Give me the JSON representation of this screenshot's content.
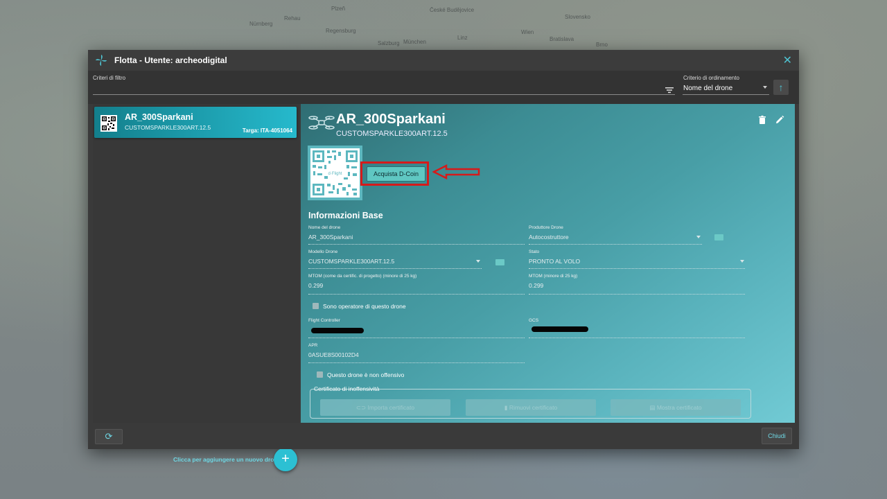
{
  "map": {
    "labels": [
      "Plzeň",
      "Rehau",
      "České Budějovice",
      "Linz",
      "Wien",
      "Salzburg",
      "München",
      "Bratislava",
      "Slovensko",
      "Nürnberg",
      "Regensburg",
      "Brno"
    ]
  },
  "dialog": {
    "title": "Flotta - Utente: archeodigital",
    "close_icon": "close-icon",
    "filter": {
      "label": "Criteri di filtro",
      "value": ""
    },
    "sort": {
      "label": "Criterio di ordinamento",
      "value": "Nome del drone",
      "direction_icon": "arrow-up-icon"
    }
  },
  "sidebar": {
    "drones": [
      {
        "name": "AR_300Sparkani",
        "model": "CUSTOMSPARKLE300ART.12.5",
        "targa": "Targa: ITA-4051064"
      }
    ],
    "add_hint": "Clicca per aggiungere un nuovo drone.",
    "add_button": "+"
  },
  "detail": {
    "name": "AR_300Sparkani",
    "model": "CUSTOMSPARKLE300ART.12.5",
    "buy_button": "Acquista D-Coin",
    "section_title": "Informazioni Base",
    "fields": {
      "nome": {
        "label": "Nome del drone",
        "value": "AR_300Sparkani"
      },
      "produttore": {
        "label": "Produttore Drone",
        "value": "Autocostruttore"
      },
      "modello": {
        "label": "Modello Drone",
        "value": "CUSTOMSPARKLE300ART.12.5"
      },
      "stato": {
        "label": "Stato",
        "value": "PRONTO AL VOLO"
      },
      "mtom_cert": {
        "label": "MTOM (come da certific. di progetto) (minore di 25 kg)",
        "value": "0.299"
      },
      "mtom": {
        "label": "MTOM (minore di 25 kg)",
        "value": "0.299"
      },
      "fc": {
        "label": "Flight Controller",
        "value": ""
      },
      "gcs": {
        "label": "GCS",
        "value": ""
      },
      "apr": {
        "label": "APR",
        "value": "0ASUE8S00102D4"
      }
    },
    "operator_check": "Sono operatore di questo drone",
    "non_offensive_check": "Questo drone è non offensivo",
    "cert_legend": "Certificato di inoffensività",
    "cert_buttons": {
      "importa": "Importa certificato",
      "rimuovi": "Rimuovi certificato",
      "mostra": "Mostra certificato"
    }
  },
  "footer": {
    "refresh_icon": "refresh-icon",
    "close_button": "Chiudi"
  },
  "colors": {
    "accent": "#2cc0d3",
    "highlight": "#d61a1a",
    "dialog_bg": "#3a3a3a"
  }
}
